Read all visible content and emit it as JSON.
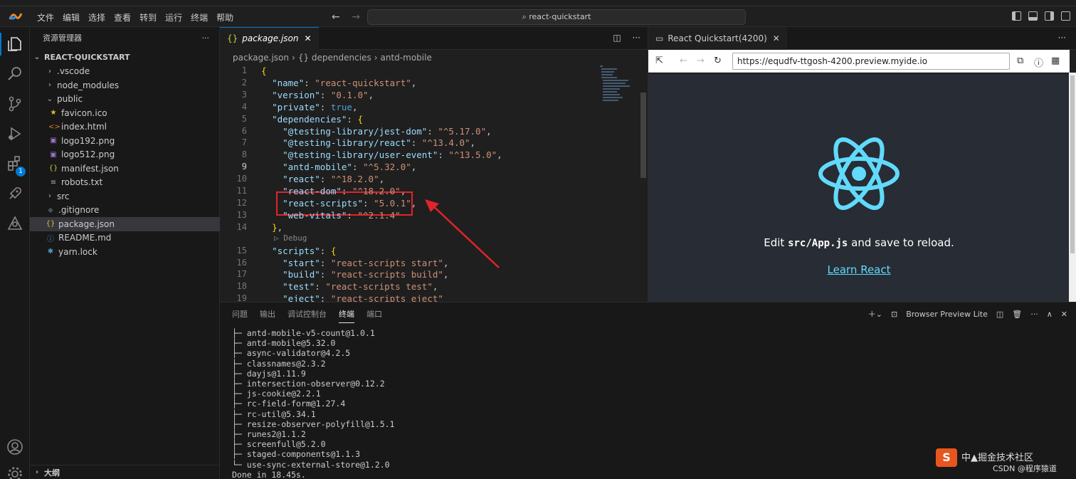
{
  "titlebar": {
    "menu": [
      "文件",
      "编辑",
      "选择",
      "查看",
      "转到",
      "运行",
      "终端",
      "帮助"
    ],
    "search": "react-quickstart",
    "icons": [
      "toggle-primary-sidebar-icon",
      "toggle-panel-icon",
      "toggle-secondary-sidebar-icon",
      "customize-layout-icon"
    ]
  },
  "activity_bar": {
    "items": [
      "explorer-icon",
      "search-icon",
      "source-control-icon",
      "run-debug-icon",
      "extensions-icon",
      "remote-icon",
      "share-icon"
    ],
    "extensions_badge": "1",
    "bottom": [
      "accounts-icon",
      "manage-icon"
    ]
  },
  "sidebar": {
    "title": "资源管理器",
    "more": "···",
    "root": "REACT-QUICKSTART",
    "items": [
      {
        "label": ".vscode",
        "type": "folder",
        "icon": "›"
      },
      {
        "label": "node_modules",
        "type": "folder",
        "icon": "›"
      },
      {
        "label": "public",
        "type": "folder-open",
        "icon": "⌄"
      },
      {
        "label": "favicon.ico",
        "type": "file",
        "icon": "★",
        "color": "#e8c02c"
      },
      {
        "label": "index.html",
        "type": "file",
        "icon": "<>",
        "color": "#e37933"
      },
      {
        "label": "logo192.png",
        "type": "file",
        "icon": "▣",
        "color": "#a074c4"
      },
      {
        "label": "logo512.png",
        "type": "file",
        "icon": "▣",
        "color": "#a074c4"
      },
      {
        "label": "manifest.json",
        "type": "file",
        "icon": "{}",
        "color": "#cbcb41"
      },
      {
        "label": "robots.txt",
        "type": "file",
        "icon": "≡",
        "color": "#aaaaaa"
      },
      {
        "label": "src",
        "type": "folder",
        "icon": "›"
      },
      {
        "label": ".gitignore",
        "type": "file",
        "icon": "◆",
        "color": "#41535b"
      },
      {
        "label": "package.json",
        "type": "file",
        "icon": "{}",
        "color": "#cbcb41",
        "selected": true
      },
      {
        "label": "README.md",
        "type": "file",
        "icon": "ⓘ",
        "color": "#519aba"
      },
      {
        "label": "yarn.lock",
        "type": "file",
        "icon": "✱",
        "color": "#519aba"
      }
    ],
    "outline": "大纲"
  },
  "editor": {
    "tab_label": "package.json",
    "tab_close": "✕",
    "breadcrumb": [
      "package.json",
      "{} dependencies",
      "antd-mobile"
    ],
    "debug_lens": "▷ Debug",
    "lines": [
      {
        "n": "1",
        "t": "{"
      },
      {
        "n": "2",
        "t": "  \"name\": \"react-quickstart\","
      },
      {
        "n": "3",
        "t": "  \"version\": \"0.1.0\","
      },
      {
        "n": "4",
        "t": "  \"private\": true,"
      },
      {
        "n": "5",
        "t": "  \"dependencies\": {"
      },
      {
        "n": "6",
        "t": "    \"@testing-library/jest-dom\": \"^5.17.0\","
      },
      {
        "n": "7",
        "t": "    \"@testing-library/react\": \"^13.4.0\","
      },
      {
        "n": "8",
        "t": "    \"@testing-library/user-event\": \"^13.5.0\","
      },
      {
        "n": "9",
        "t": "    \"antd-mobile\": \"^5.32.0\","
      },
      {
        "n": "10",
        "t": "    \"react\": \"^18.2.0\","
      },
      {
        "n": "11",
        "t": "    \"react-dom\": \"^18.2.0\","
      },
      {
        "n": "12",
        "t": "    \"react-scripts\": \"5.0.1\","
      },
      {
        "n": "13",
        "t": "    \"web-vitals\": \"^2.1.4\""
      },
      {
        "n": "14",
        "t": "  },"
      },
      {
        "n": "15",
        "t": "  \"scripts\": {"
      },
      {
        "n": "16",
        "t": "    \"start\": \"react-scripts start\","
      },
      {
        "n": "17",
        "t": "    \"build\": \"react-scripts build\","
      },
      {
        "n": "18",
        "t": "    \"test\": \"react-scripts test\","
      },
      {
        "n": "19",
        "t": "    \"eject\": \"react-scripts eject\""
      }
    ]
  },
  "preview": {
    "tab_label": "React Quickstart(4200)",
    "tab_close": "✕",
    "more": "···",
    "url": "https://equdfv-ttgosh-4200.preview.myide.io",
    "edit_prefix": "Edit ",
    "edit_code": "src/App.js",
    "edit_suffix": " and save to reload.",
    "learn": "Learn React",
    "react_color": "#61dafb"
  },
  "panel": {
    "tabs": [
      "问题",
      "输出",
      "调试控制台",
      "终端",
      "端口"
    ],
    "active_tab": "终端",
    "terminal_name": "Browser Preview Lite",
    "terminal_lines": [
      "├─ antd-mobile-v5-count@1.0.1",
      "├─ antd-mobile@5.32.0",
      "├─ async-validator@4.2.5",
      "├─ classnames@2.3.2",
      "├─ dayjs@1.11.9",
      "├─ intersection-observer@0.12.2",
      "├─ js-cookie@2.2.1",
      "├─ rc-field-form@1.27.4",
      "├─ rc-util@5.34.1",
      "├─ resize-observer-polyfill@1.5.1",
      "├─ runes2@1.1.2",
      "├─ screenfull@5.2.0",
      "├─ staged-components@1.1.3",
      "└─ use-sync-external-store@1.2.0",
      "Done in 18.45s."
    ]
  },
  "watermark": {
    "badge": "S",
    "line1": "中▲掘金技术社区",
    "line2": "CSDN @程序猿道"
  }
}
